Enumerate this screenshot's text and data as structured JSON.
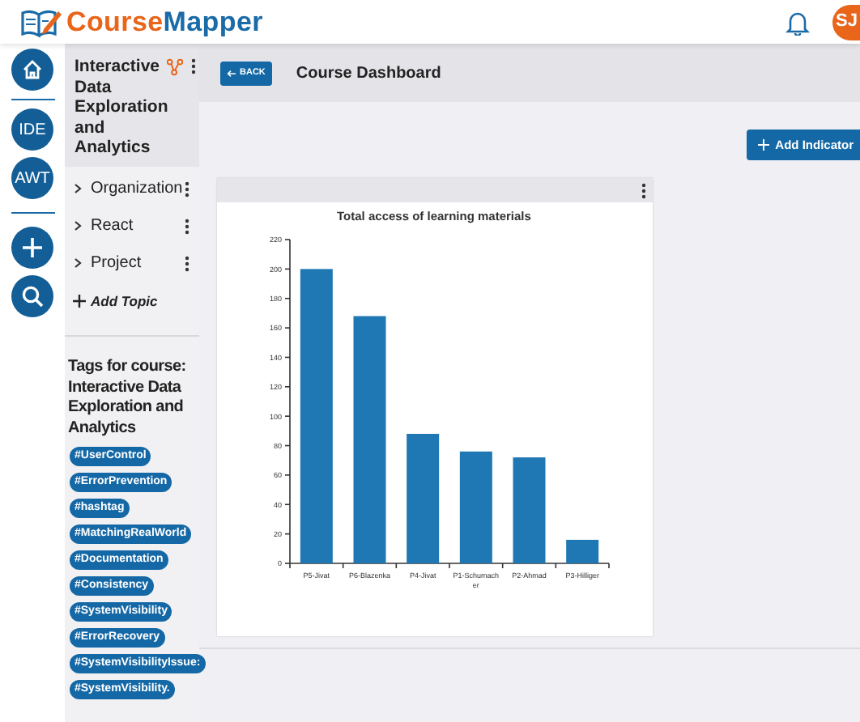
{
  "header": {
    "logo": {
      "part_1": "Course",
      "part_2": "Mapper"
    },
    "avatar": "SJ"
  },
  "rail": [
    {
      "kind": "home"
    },
    {
      "kind": "text",
      "label": "IDE"
    },
    {
      "kind": "text",
      "label": "AWT"
    },
    {
      "kind": "add"
    },
    {
      "kind": "search"
    }
  ],
  "course": {
    "title": "Interactive Data Exploration and Analytics",
    "topics": [
      {
        "label": "Organization",
        "expanded": false
      },
      {
        "label": "React",
        "expanded": false
      },
      {
        "label": "Project",
        "expanded": false
      }
    ],
    "add_topic": "Add Topic"
  },
  "tags": {
    "heading": "Tags for course: Interactive Data Exploration and Analytics",
    "items": [
      "#UserControl",
      "#ErrorPrevention",
      "#hashtag",
      "#MatchingRealWorld",
      "#Documentation",
      "#Consistency",
      "#SystemVisibility",
      "#ErrorRecovery",
      "#SystemVisibilityIssue:",
      "#SystemVisibility."
    ]
  },
  "toolbar": {
    "back": "BACK",
    "title": "Course Dashboard"
  },
  "add_indicator": "Add Indicator",
  "card": {
    "chart_data": {
      "type": "bar",
      "title": "Total access of learning materials",
      "categories": [
        "P5-Jivat",
        "P6-Blazenka",
        "P4-Jivat",
        "P1-Schumacher",
        "P2-Ahmad",
        "P3-Hilliger"
      ],
      "series": [
        {
          "color": "#1f77b4",
          "values": [
            200,
            168,
            88,
            76,
            72,
            16
          ]
        }
      ],
      "ylim": [
        0,
        220
      ],
      "yticks": [
        0,
        20,
        40,
        60,
        80,
        100,
        120,
        140,
        160,
        180,
        200,
        220
      ]
    }
  }
}
